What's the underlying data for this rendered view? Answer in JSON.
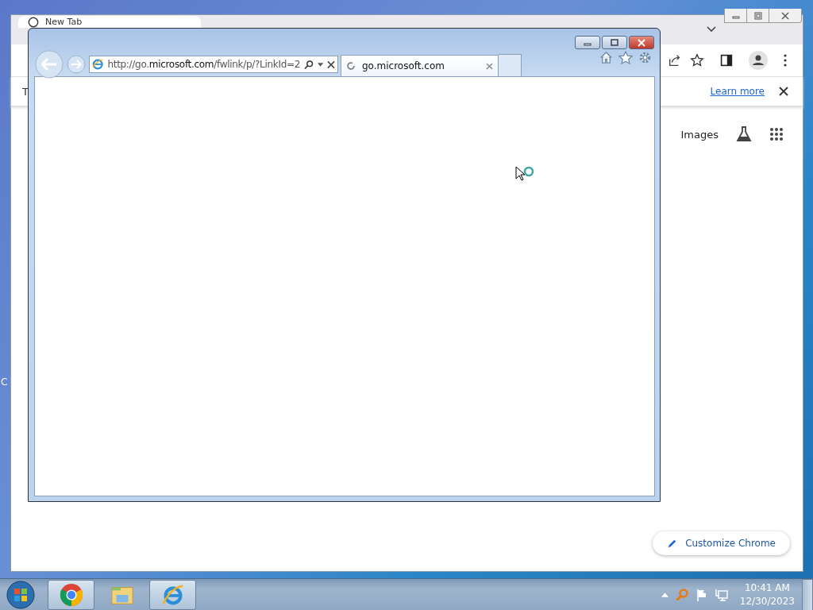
{
  "desktop": {
    "icon_label": "C"
  },
  "chrome": {
    "tab": {
      "title": "New Tab",
      "selected": true
    },
    "infobar": {
      "text": "T",
      "link": "Learn more"
    },
    "header_links": [
      "Images"
    ],
    "customize_button": "Customize Chrome"
  },
  "ie": {
    "address": {
      "prefix": "http://go.",
      "domain": "microsoft.com",
      "path": "/fwlink/p/?LinkId=2"
    },
    "tabs": [
      {
        "title": "go.microsoft.com",
        "selected": true
      }
    ]
  },
  "taskbar": {
    "apps": [
      {
        "kind": "chrome",
        "running": true
      },
      {
        "kind": "explorer",
        "running": false
      },
      {
        "kind": "ie",
        "running": true
      }
    ],
    "clock": {
      "time": "10:41 AM",
      "date": "12/30/2023"
    }
  }
}
